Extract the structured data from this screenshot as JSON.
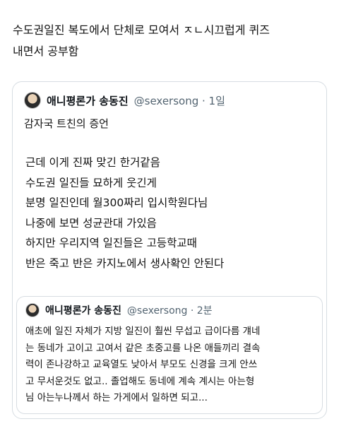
{
  "post": {
    "lines": [
      "수도권일진 복도에서 단체로 모여서 ㅈㄴ시끄럽게 퀴즈",
      "내면서 공부함"
    ]
  },
  "quoted_tweet": {
    "author_name": "애니평론가 송동진",
    "handle_time": "@sexersong · 1일",
    "subtitle": "감자국 트친의 증언",
    "body_lines": [
      "근데 이게 진짜 맞긴 한거같음",
      "수도권 일진들 묘하게 웃긴게",
      "분명 일진인데 월300짜리 입시학원다님",
      "나중에 보면 성균관대 가있음",
      "하지만 우리지역 일진들은 고등학교때",
      "반은 죽고 반은 카지노에서 생사확인 안된다"
    ],
    "nested_tweet": {
      "author_name": "애니평론가 송동진",
      "handle_time": "@sexersong · 2분",
      "body_lines": [
        "애초에 일진 자체가 지방 일진이 훨씬 무섭고 급이다름 걔네",
        "는 동네가 고이고 고여서 같은 초중고를 나온 애들끼리 결속",
        "력이 존나강하고 교육열도 낮아서 부모도 신경을 크게 안쓰",
        "고 무서운것도 없고.. 졸업해도 동네에 계속 계시는 아는형",
        "님 아는누나께서 하는 가게에서 일하면 되고..."
      ]
    }
  }
}
